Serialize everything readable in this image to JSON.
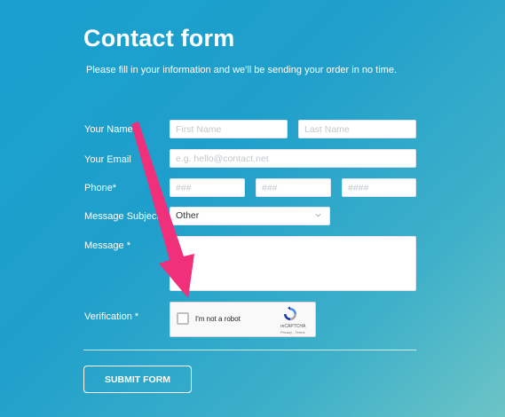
{
  "header": {
    "title": "Contact form",
    "subtitle": "Please fill in your information and we'll be sending your order in no time."
  },
  "form": {
    "name_label": "Your Name",
    "first_name_placeholder": "First Name",
    "last_name_placeholder": "Last Name",
    "email_label": "Your Email",
    "email_placeholder": "e.g. hello@contact.net",
    "phone_label": "Phone*",
    "phone_area_placeholder": "###",
    "phone_prefix_placeholder": "###",
    "phone_line_placeholder": "####",
    "subject_label": "Message Subject *",
    "subject_selected": "Other",
    "message_label": "Message *",
    "message_value": "",
    "verification_label": "Verification *",
    "captcha_text": "I'm not a robot",
    "captcha_brand": "reCAPTCHA",
    "captcha_terms": "Privacy - Terms",
    "submit_label": "SUBMIT FORM"
  },
  "annotation": {
    "arrow_color": "#f0307a"
  },
  "icons": [
    "chevron-down-icon",
    "recaptcha-logo-icon",
    "arrow-annotation-icon"
  ]
}
